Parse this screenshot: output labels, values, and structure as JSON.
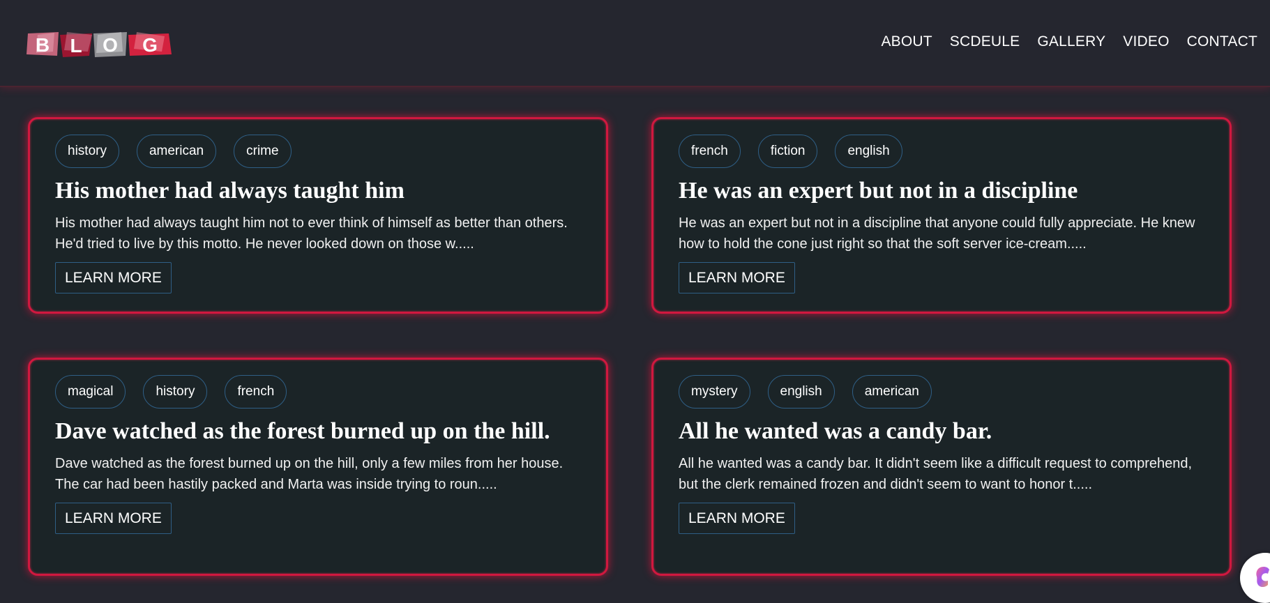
{
  "header": {
    "logo_text": "BLOG",
    "nav": [
      "ABOUT",
      "SCDEULE",
      "GALLERY",
      "VIDEO",
      "CONTACT"
    ]
  },
  "colors": {
    "background": "#25262f",
    "card_background": "#1b2427",
    "card_border_glow": "#d0183f",
    "tag_border": "#2f5f86"
  },
  "posts": [
    {
      "tags": [
        "history",
        "american",
        "crime"
      ],
      "title": "His mother had always taught him",
      "excerpt": "His mother had always taught him not to ever think of himself as better than others. He'd tried to live by this motto. He never looked down on those w.....",
      "button": "LEARN MORE"
    },
    {
      "tags": [
        "french",
        "fiction",
        "english"
      ],
      "title": "He was an expert but not in a discipline",
      "excerpt": "He was an expert but not in a discipline that anyone could fully appreciate. He knew how to hold the cone just right so that the soft server ice-cream.....",
      "button": "LEARN MORE"
    },
    {
      "tags": [
        "magical",
        "history",
        "french"
      ],
      "title": "Dave watched as the forest burned up on the hill.",
      "excerpt": "Dave watched as the forest burned up on the hill, only a few miles from her house. The car had been hastily packed and Marta was inside trying to roun.....",
      "button": "LEARN MORE"
    },
    {
      "tags": [
        "mystery",
        "english",
        "american"
      ],
      "title": "All he wanted was a candy bar.",
      "excerpt": "All he wanted was a candy bar. It didn't seem like a difficult request to comprehend, but the clerk remained frozen and didn't seem to want to honor t.....",
      "button": "LEARN MORE"
    }
  ],
  "fab": {
    "icon": "assistant-icon"
  }
}
